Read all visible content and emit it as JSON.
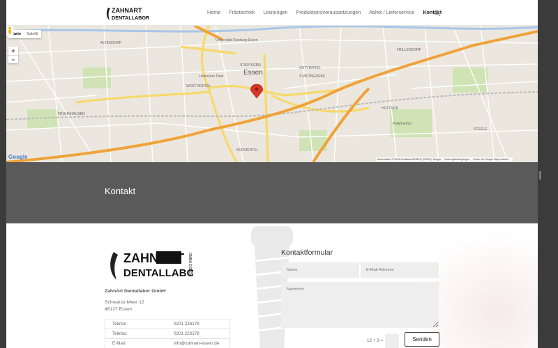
{
  "header": {
    "logo_top": "ZAHNART",
    "logo_bottom": "DENTALLABOR",
    "logo_side": "GMBH ESSEN",
    "nav": [
      {
        "label": "Home"
      },
      {
        "label": "Frästechnik"
      },
      {
        "label": "Leistungen"
      },
      {
        "label": "Produktionsvoraussetzungen"
      },
      {
        "label": "Abhol / Lieferservice"
      },
      {
        "label": "Kontakt",
        "active": true
      }
    ],
    "search_icon": "search-icon"
  },
  "map": {
    "type_buttons": [
      "Karte",
      "Satellit"
    ],
    "zoom_in": "+",
    "zoom_out": "−",
    "google": "Google",
    "attribution": [
      "Kartendaten © 2016 GeoBasis-DE/BKG (©2009), Google",
      "Nutzungsbedingungen",
      "Fehler bei Google Maps melden"
    ],
    "labels": {
      "essen": "Essen",
      "stadtkern": "STADTKERN",
      "westviertel": "WESTVIERTEL",
      "ostviertel": "OSTVIERTEL",
      "frohnhausen": "FROHNHAUSEN",
      "altendorf": "ALTENDORF",
      "huttrop": "HUTTROP",
      "stadtbezirk": "STADTBEZIRKE",
      "suedviertel": "SÜDVIERTEL",
      "frillendorf": "FRILLENDORF",
      "steele": "STEELE",
      "uni": "Universität Duisburg-Essen",
      "limbecker": "Limbecker Platz",
      "parkfriedhof": "Parkfriedhof"
    },
    "colors": {
      "highway": "#f2a33a",
      "major": "#fbe28a",
      "water": "#a9c6e8",
      "park": "#c6dea4",
      "marker": "#d8362b"
    }
  },
  "band": {
    "title": "Kontakt"
  },
  "company": {
    "name": "ZahnArt Dentallabor GmbH",
    "street": "Schwarze Meer 12",
    "city": "45127 Essen"
  },
  "contact_table": [
    {
      "key": "Telefon:",
      "value": "0201 226178"
    },
    {
      "key": "Telefax:",
      "value": "0201 226178"
    },
    {
      "key": "E-Mail:",
      "value": "info@zahnart-essen.de"
    }
  ],
  "form": {
    "title": "Kontaktformular",
    "name_placeholder": "Name",
    "email_placeholder": "E-Mail-Adresse",
    "message_placeholder": "Nachricht",
    "captcha": "12 + 3 =",
    "submit": "Senden"
  }
}
